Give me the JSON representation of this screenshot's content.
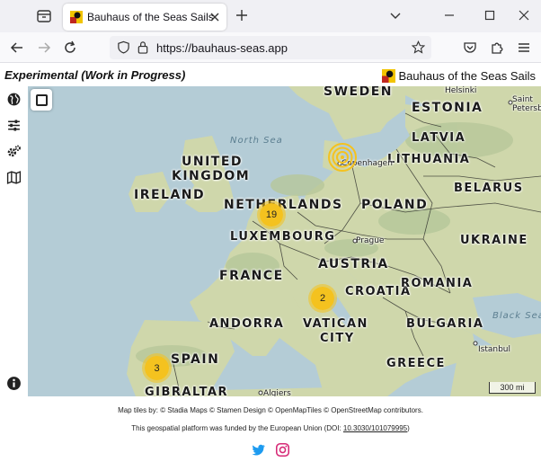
{
  "browser": {
    "tab_title": "Bauhaus of the Seas Sails",
    "url": "https://bauhaus-seas.app"
  },
  "app": {
    "subtitle": "Experimental (Work in Progress)",
    "brand": "Bauhaus of the Seas Sails"
  },
  "toolbar": {
    "items": [
      "globe-icon",
      "sliders-icon",
      "gears-icon",
      "map-icon"
    ],
    "info": "info-icon"
  },
  "map": {
    "countries": [
      {
        "name": "SWEDEN"
      },
      {
        "name": "ESTONIA"
      },
      {
        "name": "LATVIA"
      },
      {
        "name": "UNITED"
      },
      {
        "name": "KINGDOM"
      },
      {
        "name": "LITHUANIA"
      },
      {
        "name": "IRELAND"
      },
      {
        "name": "BELARUS"
      },
      {
        "name": "NETHERLANDS"
      },
      {
        "name": "POLAND"
      },
      {
        "name": "LUXEMBOURG"
      },
      {
        "name": "UKRAINE"
      },
      {
        "name": "AUSTRIA"
      },
      {
        "name": "FRANCE"
      },
      {
        "name": "CROATIA"
      },
      {
        "name": "ROMANIA"
      },
      {
        "name": "ANDORRA"
      },
      {
        "name": "VATICAN"
      },
      {
        "name": "BULGARIA"
      },
      {
        "name": "CITY"
      },
      {
        "name": "SPAIN"
      },
      {
        "name": "GREECE"
      },
      {
        "name": "GIBRALTAR"
      }
    ],
    "seas": [
      "North Sea",
      "Black Sea"
    ],
    "cities": [
      "Helsinki",
      "Saint",
      "Petersburg",
      "Copenhagen",
      "Prague",
      "Istanbul",
      "Algiers"
    ],
    "clusters": [
      "19",
      "2",
      "3"
    ],
    "scale": "300 mi"
  },
  "footer": {
    "credits": "Map tiles by: © Stadia Maps © Stamen Design © OpenMapTiles © OpenStreetMap contributors.",
    "funding_prefix": "This geospatial platform was funded by the European Union (DOI: ",
    "doi": "10.3030/101079995",
    "funding_suffix": ")"
  }
}
